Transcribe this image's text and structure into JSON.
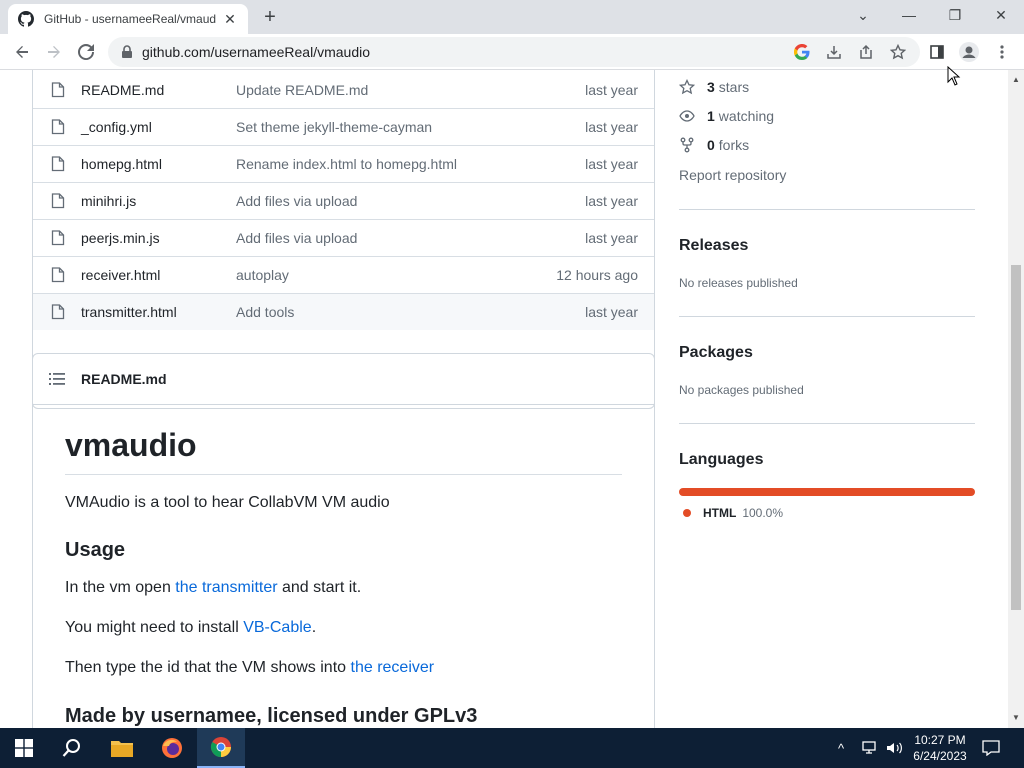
{
  "browser": {
    "tab_title": "GitHub - usernameeReal/vmaudio",
    "url": "github.com/usernameeReal/vmaudio"
  },
  "files": [
    {
      "name": "README.md",
      "message": "Update README.md",
      "date": "last year"
    },
    {
      "name": "_config.yml",
      "message": "Set theme jekyll-theme-cayman",
      "date": "last year"
    },
    {
      "name": "homepg.html",
      "message": "Rename index.html to homepg.html",
      "date": "last year"
    },
    {
      "name": "minihri.js",
      "message": "Add files via upload",
      "date": "last year"
    },
    {
      "name": "peerjs.min.js",
      "message": "Add files via upload",
      "date": "last year"
    },
    {
      "name": "receiver.html",
      "message": "autoplay",
      "date": "12 hours ago"
    },
    {
      "name": "transmitter.html",
      "message": "Add tools",
      "date": "last year"
    }
  ],
  "readme": {
    "header": "README.md",
    "title": "vmaudio",
    "intro": "VMAudio is a tool to hear CollabVM VM audio",
    "usage_heading": "Usage",
    "p1_before": "In the vm open ",
    "p1_link": "the transmitter",
    "p1_after": " and start it.",
    "p2_before": "You might need to install ",
    "p2_link": "VB-Cable",
    "p2_after": ".",
    "p3_before": "Then type the id that the VM shows into ",
    "p3_link": "the receiver",
    "footer_heading": "Made by usernamee, licensed under GPLv3"
  },
  "sidebar": {
    "stars_count": "3",
    "stars_label": "stars",
    "watching_count": "1",
    "watching_label": "watching",
    "forks_count": "0",
    "forks_label": "forks",
    "report": "Report repository",
    "releases_heading": "Releases",
    "releases_text": "No releases published",
    "packages_heading": "Packages",
    "packages_text": "No packages published",
    "languages_heading": "Languages",
    "languages": [
      {
        "name": "HTML",
        "percent": "100.0%",
        "color": "#e34c26"
      }
    ]
  },
  "taskbar": {
    "time": "10:27 PM",
    "date": "6/24/2023"
  }
}
